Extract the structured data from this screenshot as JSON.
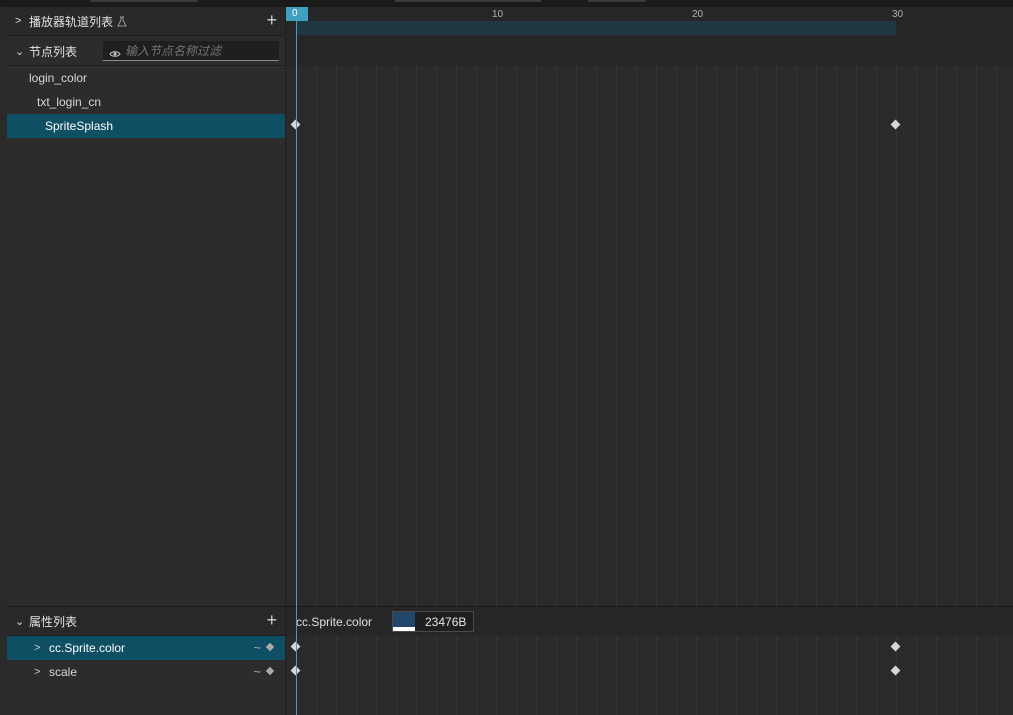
{
  "panels": {
    "player_tracks": {
      "title": "播放器轨道列表",
      "add_label": "+",
      "chevron": ">"
    },
    "node_list": {
      "title": "节点列表",
      "chevron": "v",
      "filter_placeholder": "输入节点名称过滤"
    },
    "property_list": {
      "title": "属性列表",
      "add_label": "+",
      "chevron": "v"
    }
  },
  "nodes": [
    {
      "label": "login_color"
    },
    {
      "label": "txt_login_cn"
    },
    {
      "label": "SpriteSplash"
    }
  ],
  "ruler": {
    "current_frame": "0",
    "ticks": [
      "10",
      "20",
      "30"
    ]
  },
  "property_editor": {
    "property_name": "cc.Sprite.color",
    "color_hex": "23476B",
    "swatch_color": "#23476B"
  },
  "properties": [
    {
      "label": "cc.Sprite.color",
      "chevron": ">",
      "curve_icon": "~"
    },
    {
      "label": "scale",
      "chevron": ">",
      "curve_icon": "~"
    }
  ],
  "keyframes": {
    "SpriteSplash": [
      0,
      30
    ],
    "cc.Sprite.color": [
      0,
      30
    ],
    "scale": [
      0,
      30
    ]
  },
  "colors": {
    "accent": "#3FA0C0",
    "selection": "#0F4F63"
  }
}
